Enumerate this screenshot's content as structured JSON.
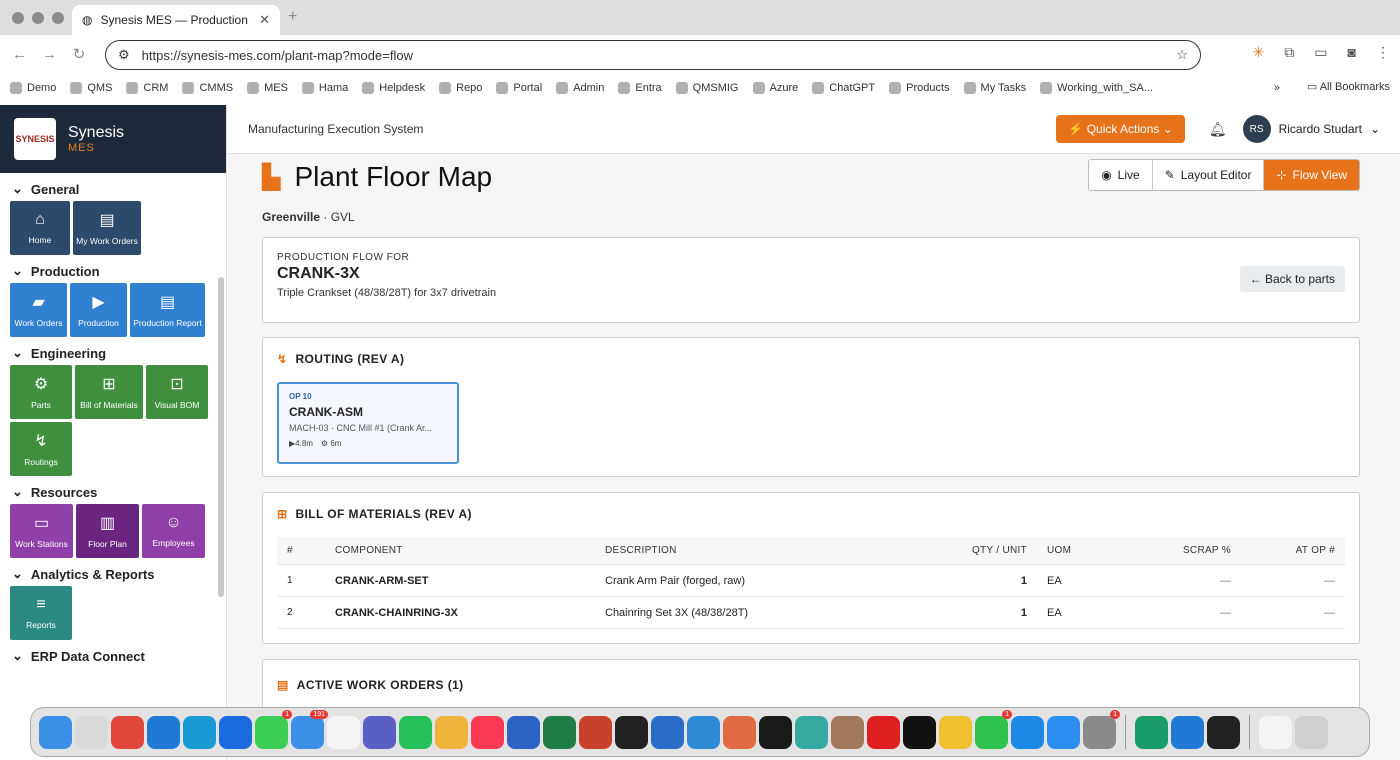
{
  "browser": {
    "tab_title": "Synesis MES — Production Tr",
    "tab_close": "✕",
    "new_tab": "+",
    "url": "https://synesis-mes.com/plant-map?mode=flow",
    "bookmarks": [
      "Demo",
      "QMS",
      "CRM",
      "CMMS",
      "MES",
      "Hama",
      "Helpdesk",
      "Repo",
      "Portal",
      "Admin",
      "Entra",
      "QMSMIG",
      "Azure",
      "ChatGPT",
      "Products",
      "My Tasks",
      "Working_with_SA..."
    ],
    "all_bookmarks": "All Bookmarks",
    "more": "»"
  },
  "sidebar": {
    "brand": "Synesis",
    "brand_sub": "MES",
    "logo_text": "SYNESIS",
    "sections": [
      {
        "title": "General",
        "tiles": [
          {
            "label": "Home",
            "icon": "⌂",
            "color": "#2c4a6b"
          },
          {
            "label": "My Work Orders",
            "icon": "▤",
            "color": "#2c4a6b"
          }
        ]
      },
      {
        "title": "Production",
        "tiles": [
          {
            "label": "Work Orders",
            "icon": "▰",
            "color": "#2f80d0"
          },
          {
            "label": "Production",
            "icon": "▶",
            "color": "#2f80d0"
          },
          {
            "label": "Production Report",
            "icon": "▤",
            "color": "#2f80d0"
          }
        ]
      },
      {
        "title": "Engineering",
        "tiles": [
          {
            "label": "Parts",
            "icon": "⚙",
            "color": "#3f8f3f"
          },
          {
            "label": "Bill of Materials",
            "icon": "⊞",
            "color": "#3f8f3f"
          },
          {
            "label": "Visual BOM",
            "icon": "⊡",
            "color": "#3f8f3f"
          },
          {
            "label": "Routings",
            "icon": "↯",
            "color": "#3f8f3f"
          }
        ]
      },
      {
        "title": "Resources",
        "tiles": [
          {
            "label": "Work Stations",
            "icon": "▭",
            "color": "#8e3fa8"
          },
          {
            "label": "Floor Plan",
            "icon": "▥",
            "color": "#6a2580"
          },
          {
            "label": "Employees",
            "icon": "☺",
            "color": "#8e3fa8"
          }
        ]
      },
      {
        "title": "Analytics & Reports",
        "tiles": [
          {
            "label": "Reports",
            "icon": "≡",
            "color": "#2a8a80"
          }
        ]
      },
      {
        "title": "ERP Data Connect",
        "tiles": []
      }
    ]
  },
  "header": {
    "system_title": "Manufacturing Execution System",
    "quick_actions": "Quick Actions",
    "user_initials": "RS",
    "user_name": "Ricardo Studart"
  },
  "page": {
    "title": "Plant Floor Map",
    "site_bold": "Greenville",
    "site_rest": " · GVL",
    "views": [
      "Live",
      "Layout Editor",
      "Flow View"
    ],
    "flow_caption": "PRODUCTION FLOW FOR",
    "part": "CRANK-3X",
    "part_desc": "Triple Crankset (48/38/28T) for 3x7 drivetrain",
    "back_label": "Back to parts",
    "routing_title": "ROUTING (REV A)",
    "op": {
      "num": "OP 10",
      "code": "CRANK-ASM",
      "machine": "MACH-03 · CNC Mill #1 (Crank Ar...",
      "run": "4.8m",
      "setup": "6m"
    },
    "bom_title": "BILL OF MATERIALS (REV A)",
    "bom_headers": [
      "#",
      "COMPONENT",
      "DESCRIPTION",
      "QTY / UNIT",
      "UOM",
      "SCRAP %",
      "AT OP #"
    ],
    "bom_rows": [
      [
        "1",
        "CRANK-ARM-SET",
        "Crank Arm Pair (forged, raw)",
        "1",
        "EA",
        "—",
        "—"
      ],
      [
        "2",
        "CRANK-CHAINRING-3X",
        "Chainring Set 3X (48/38/28T)",
        "1",
        "EA",
        "—",
        "—"
      ]
    ],
    "wo_title": "ACTIVE WORK ORDERS (1)"
  },
  "dock": {
    "apps": [
      {
        "name": "finder",
        "color": "#3b8fe6"
      },
      {
        "name": "launchpad",
        "color": "#d9d9d9"
      },
      {
        "name": "chrome",
        "color": "#e0463a"
      },
      {
        "name": "windows",
        "color": "#1f7ad6"
      },
      {
        "name": "edge",
        "color": "#1b9bd6"
      },
      {
        "name": "dropbox",
        "color": "#1b6be0"
      },
      {
        "name": "messages",
        "color": "#3ccd55",
        "badge": "1"
      },
      {
        "name": "mail",
        "color": "#3b8fe6",
        "badge": "191"
      },
      {
        "name": "calendar",
        "color": "#f4f4f4"
      },
      {
        "name": "teams",
        "color": "#5a5fc5"
      },
      {
        "name": "whatsapp",
        "color": "#25c05a"
      },
      {
        "name": "photos",
        "color": "#f0b33c"
      },
      {
        "name": "music",
        "color": "#fa3a55"
      },
      {
        "name": "word",
        "color": "#2b64c2"
      },
      {
        "name": "excel",
        "color": "#1e7e45"
      },
      {
        "name": "powerpoint",
        "color": "#c8412a"
      },
      {
        "name": "terminal",
        "color": "#222"
      },
      {
        "name": "outlook",
        "color": "#2a6dc8"
      },
      {
        "name": "s-app",
        "color": "#2f8ad8"
      },
      {
        "name": "claude",
        "color": "#e06a42"
      },
      {
        "name": "activity",
        "color": "#1a1a1a"
      },
      {
        "name": "time-machine",
        "color": "#35a9a0"
      },
      {
        "name": "contacts",
        "color": "#a2785a"
      },
      {
        "name": "youtube",
        "color": "#e02020"
      },
      {
        "name": "tv",
        "color": "#111"
      },
      {
        "name": "preview",
        "color": "#f0c030"
      },
      {
        "name": "facetime",
        "color": "#2fc24c",
        "badge": "1"
      },
      {
        "name": "q-app",
        "color": "#1e88e5"
      },
      {
        "name": "app-store",
        "color": "#2b8ef0"
      },
      {
        "name": "settings",
        "color": "#8a8a8a",
        "badge": "1"
      }
    ],
    "apps2": [
      {
        "name": "grammarly",
        "color": "#1a9c6a"
      },
      {
        "name": "vscode",
        "color": "#1f7ad6"
      },
      {
        "name": "stocks",
        "color": "#222"
      }
    ],
    "apps3": [
      {
        "name": "documents",
        "color": "#f4f4f4"
      },
      {
        "name": "trash",
        "color": "#d0d0d0"
      }
    ]
  }
}
